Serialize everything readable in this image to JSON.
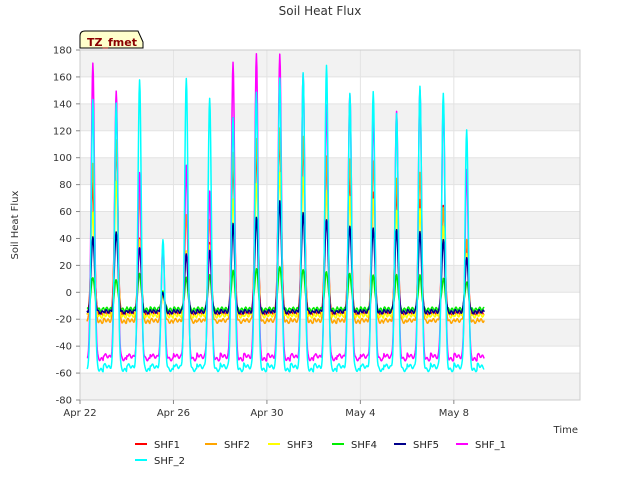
{
  "chart_data": {
    "type": "line",
    "title": "Soil Heat Flux",
    "xlabel": "Time",
    "ylabel": "Soil Heat Flux",
    "badge": "TZ_fmet",
    "ylim": [
      -80,
      180
    ],
    "yticks": [
      -80,
      -60,
      -40,
      -20,
      0,
      20,
      40,
      60,
      80,
      100,
      120,
      140,
      160,
      180
    ],
    "xlim": [
      0,
      21.4
    ],
    "xticks": [
      {
        "x": 0,
        "label": "Apr 22"
      },
      {
        "x": 4,
        "label": "Apr 26"
      },
      {
        "x": 8,
        "label": "Apr 30"
      },
      {
        "x": 12,
        "label": "May 4"
      },
      {
        "x": 16,
        "label": "May 8"
      }
    ],
    "grid": true,
    "legend_position": "bottom",
    "x_units": "days since Apr 22 00:00",
    "start_day": 0.3,
    "end_day": 17.3,
    "peak_hour": 0.55,
    "series": [
      {
        "name": "SHF1",
        "color": "#ff0000",
        "base": -16,
        "peaks": [
          80,
          110,
          40,
          0,
          30,
          38,
          95,
          105,
          115,
          110,
          100,
          85,
          75,
          75,
          70,
          65,
          35
        ]
      },
      {
        "name": "SHF2",
        "color": "#ffa500",
        "base": -22,
        "peaks": [
          95,
          112,
          72,
          0,
          58,
          55,
          105,
          115,
          122,
          115,
          100,
          98,
          97,
          85,
          90,
          64,
          40
        ]
      },
      {
        "name": "SHF3",
        "color": "#ffff00",
        "base": -18,
        "peaks": [
          60,
          82,
          38,
          0,
          30,
          35,
          70,
          82,
          90,
          86,
          75,
          70,
          68,
          60,
          62,
          50,
          30
        ]
      },
      {
        "name": "SHF4",
        "color": "#00ee00",
        "base": -13,
        "peaks": [
          12,
          10,
          14,
          0,
          10,
          12,
          16,
          18,
          20,
          18,
          16,
          14,
          12,
          12,
          12,
          10,
          8
        ]
      },
      {
        "name": "SHF5",
        "color": "#00008b",
        "base": -15,
        "peaks": [
          42,
          46,
          34,
          0,
          28,
          30,
          50,
          55,
          68,
          60,
          55,
          50,
          48,
          46,
          44,
          38,
          25
        ]
      },
      {
        "name": "SHF_1",
        "color": "#ff00ff",
        "base": -50,
        "peaks": [
          170,
          150,
          90,
          35,
          95,
          75,
          170,
          176,
          176,
          162,
          140,
          148,
          133,
          135,
          150,
          140,
          90
        ]
      },
      {
        "name": "SHF_2",
        "color": "#00ffff",
        "base": -58,
        "peaks": [
          142,
          140,
          158,
          40,
          160,
          145,
          130,
          148,
          158,
          162,
          168,
          148,
          150,
          134,
          154,
          148,
          120
        ]
      }
    ]
  }
}
